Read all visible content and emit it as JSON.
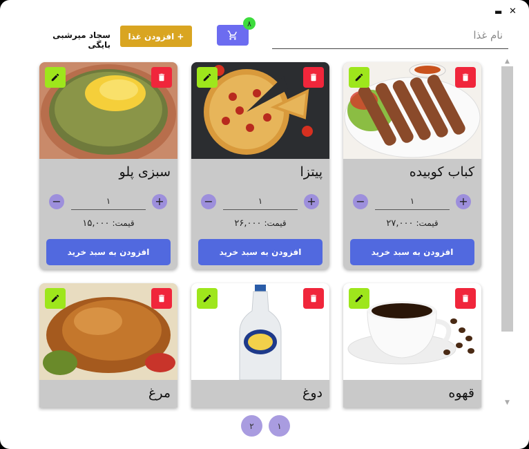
{
  "window": {
    "minimize_label": "▬",
    "close_label": "✕"
  },
  "header": {
    "search_placeholder": "نام غذا",
    "cart_count": "۸",
    "add_food_label": "+ افزودن غذا",
    "username": "سجاد میرشبی بایگی"
  },
  "colors": {
    "buy": "#5169df",
    "edit": "#9ee61c",
    "delete": "#f0263b",
    "add_food": "#d9a521",
    "cart": "#6c6cf0"
  },
  "cards": [
    {
      "name": "کباب کوبیده",
      "qty": "۱",
      "price_label": "قیمت:",
      "price": "۲۷,۰۰۰",
      "buy_label": "افزودن به سبد خرید",
      "image": "kebab"
    },
    {
      "name": "پیتزا",
      "qty": "۱",
      "price_label": "قیمت:",
      "price": "۲۶,۰۰۰",
      "buy_label": "افزودن به سبد خرید",
      "image": "pizza"
    },
    {
      "name": "سبزی پلو",
      "qty": "۱",
      "price_label": "قیمت:",
      "price": "۱۵,۰۰۰",
      "buy_label": "افزودن به سبد خرید",
      "image": "sabzi-polo"
    },
    {
      "name": "قهوه",
      "image": "coffee"
    },
    {
      "name": "دوغ",
      "image": "doogh"
    },
    {
      "name": "مرغ",
      "image": "chicken"
    }
  ],
  "pagination": {
    "page1": "۱",
    "page2": "۲"
  }
}
